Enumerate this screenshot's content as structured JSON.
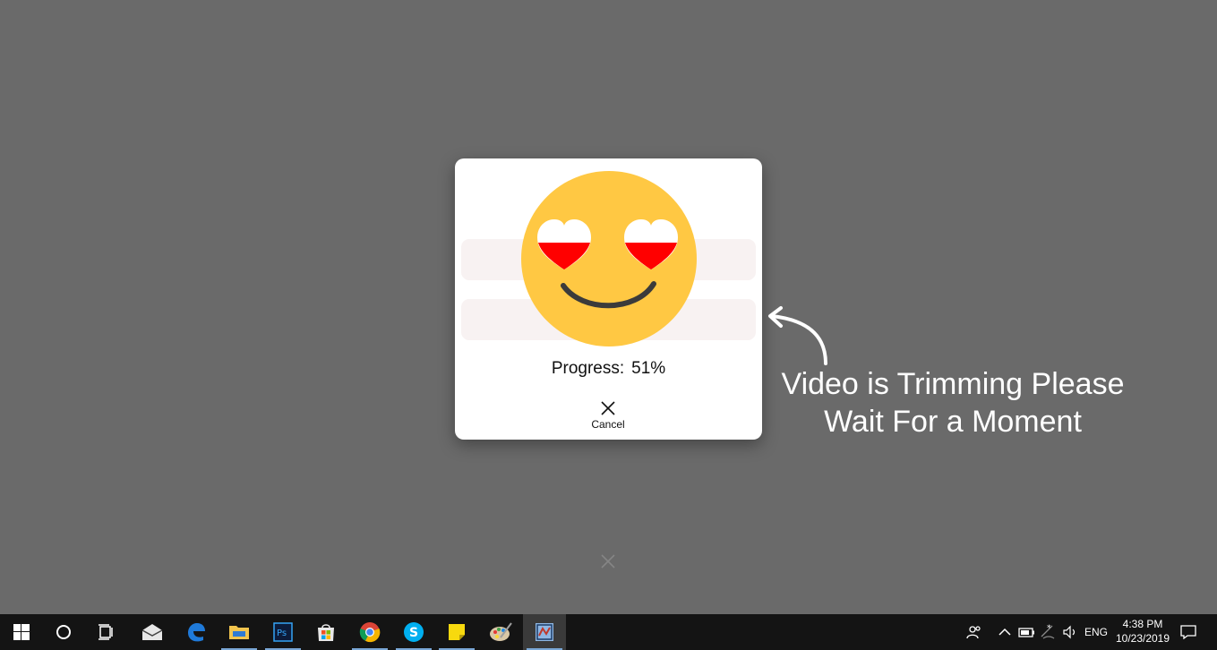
{
  "dialog": {
    "progress_label": "Progress:",
    "progress_value": "51%",
    "cancel_label": "Cancel",
    "emoji_icon": "heart-eyes-smiley-icon",
    "colors": {
      "face": "#ffc843",
      "heart_red": "#ff0000",
      "smile": "#3b3b3b"
    }
  },
  "background": {
    "ghost_cancel_icon": "close-icon"
  },
  "annotation": {
    "line1": "Video is Trimming Please",
    "line2": "Wait For a Moment",
    "arrow_icon": "curved-arrow-icon"
  },
  "taskbar": {
    "items": [
      {
        "name": "start-button",
        "icon": "windows-logo-icon"
      },
      {
        "name": "cortana-button",
        "icon": "circle-icon"
      },
      {
        "name": "task-view-button",
        "icon": "task-view-icon"
      },
      {
        "name": "mail-app",
        "icon": "mail-icon"
      },
      {
        "name": "edge-app",
        "icon": "edge-icon"
      },
      {
        "name": "file-explorer-app",
        "icon": "folder-icon"
      },
      {
        "name": "photoshop-app",
        "icon": "photoshop-icon"
      },
      {
        "name": "store-app",
        "icon": "store-bag-icon"
      },
      {
        "name": "chrome-app",
        "icon": "chrome-icon"
      },
      {
        "name": "skype-app",
        "icon": "skype-icon"
      },
      {
        "name": "sticky-notes-app",
        "icon": "sticky-note-icon"
      },
      {
        "name": "paint-app",
        "icon": "paint-palette-icon"
      },
      {
        "name": "video-trimmer-app",
        "icon": "video-app-icon"
      }
    ],
    "tray": {
      "language": "ENG",
      "time": "4:38 PM",
      "date": "10/23/2019"
    }
  }
}
